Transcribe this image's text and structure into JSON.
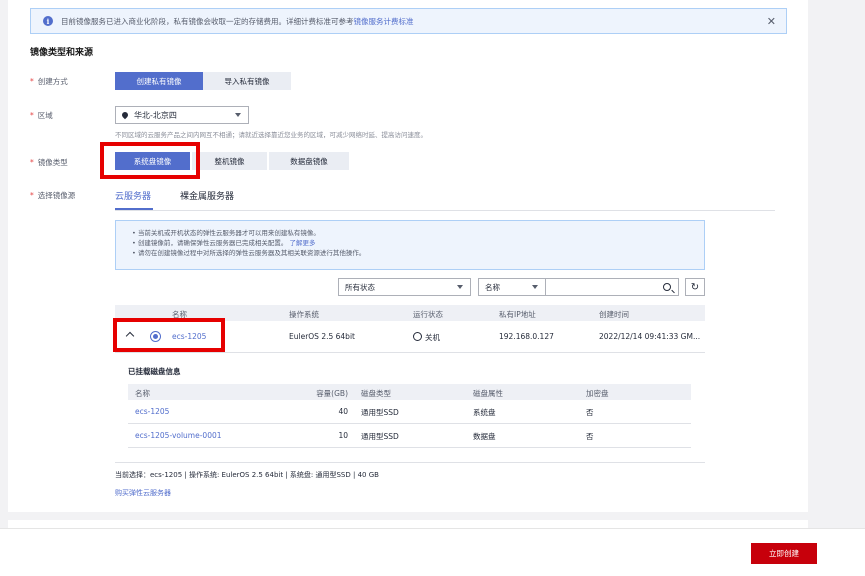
{
  "notice": {
    "text": "目前镜像服务已进入商业化阶段，私有镜像会收取一定的存储费用。详细计费标准可参考",
    "link": "镜像服务计费标准"
  },
  "section_title": "镜像类型和来源",
  "form": {
    "create_method_label": "创建方式",
    "create_private": "创建私有镜像",
    "import_private": "导入私有镜像",
    "region_label": "区域",
    "region_value": "华北-北京四",
    "region_hint": "不同区域的云服务产品之间内网互不相通；请就近选择靠近您业务的区域，可减少网络时延、提高访问速度。",
    "image_type_label": "镜像类型",
    "image_types": [
      "系统盘镜像",
      "整机镜像",
      "数据盘镜像"
    ],
    "source_label": "选择镜像源"
  },
  "tabs": [
    "云服务器",
    "裸金属服务器"
  ],
  "info_box": {
    "line1": "当前关机或开机状态的弹性云服务器才可以用来创建私有镜像。",
    "line2": "创建镜像前，请确保弹性云服务器已完成相关配置。",
    "line2_link": "了解更多",
    "line3": "请勿在创建镜像过程中对所选择的弹性云服务器及其相关联资源进行其他操作。"
  },
  "filters": {
    "status": "所有状态",
    "field": "名称"
  },
  "table": {
    "headers": [
      "名称",
      "操作系统",
      "运行状态",
      "私有IP地址",
      "创建时间"
    ],
    "row": {
      "name": "ecs-1205",
      "os": "EulerOS 2.5 64bit",
      "status": "关机",
      "ip": "192.168.0.127",
      "created": "2022/12/14 09:41:33 GM..."
    }
  },
  "disks": {
    "title": "已挂载磁盘信息",
    "headers": [
      "名称",
      "容量(GB)",
      "磁盘类型",
      "磁盘属性",
      "加密盘"
    ],
    "rows": [
      {
        "name": "ecs-1205",
        "size": "40",
        "type": "通用型SSD",
        "attr": "系统盘",
        "enc": "否"
      },
      {
        "name": "ecs-1205-volume-0001",
        "size": "10",
        "type": "通用型SSD",
        "attr": "数据盘",
        "enc": "否"
      }
    ]
  },
  "summary": "当前选择：ecs-1205 | 操作系统: EulerOS 2.5 64bit | 系统盘: 通用型SSD | 40 GB",
  "buy_link": "购买弹性云服务器",
  "create_button": "立即创建",
  "colors": {
    "accent": "#526ecc",
    "danger": "#c7000b",
    "highlight": "#e60000"
  }
}
